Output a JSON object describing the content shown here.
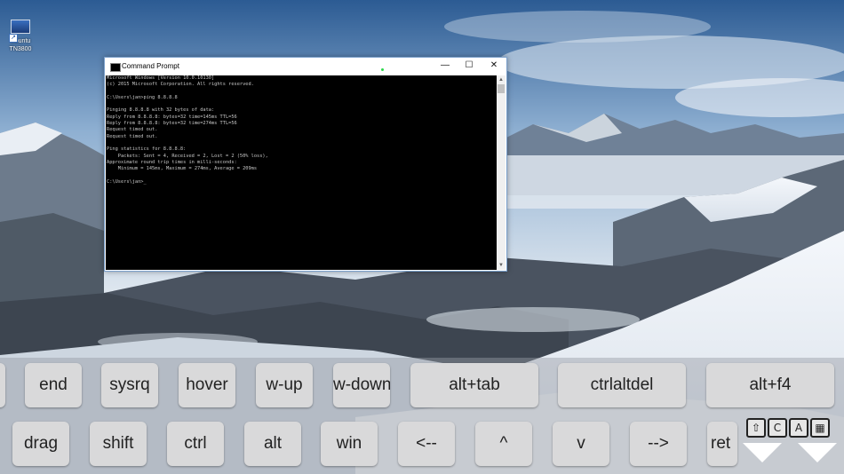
{
  "desktop": {
    "icon_label_line1": "Ubuntu",
    "icon_label_line2": "TN3800"
  },
  "cmd_window": {
    "title": "Command Prompt",
    "min_glyph": "—",
    "max_glyph": "☐",
    "close_glyph": "✕",
    "lines": [
      "Microsoft Windows [Version 10.0.10130]",
      "(c) 2015 Microsoft Corporation. All rights reserved.",
      "",
      "C:\\Users\\jan>ping 8.8.8.8",
      "",
      "Pinging 8.8.8.8 with 32 bytes of data:",
      "Reply from 8.8.8.8: bytes=32 time=145ms TTL=56",
      "Reply from 8.8.8.8: bytes=32 time=274ms TTL=56",
      "Request timed out.",
      "Request timed out.",
      "",
      "Ping statistics for 8.8.8.8:",
      "    Packets: Sent = 4, Received = 2, Lost = 2 (50% loss),",
      "Approximate round trip times in milli-seconds:",
      "    Minimum = 145ms, Maximum = 274ms, Average = 209ms",
      "",
      "C:\\Users\\jan>_"
    ]
  },
  "keys_row1": [
    "end",
    "sysrq",
    "hover",
    "w-up",
    "w-down",
    "alt+tab",
    "ctrlaltdel",
    "alt+f4"
  ],
  "keys_row2": [
    "drag",
    "shift",
    "ctrl",
    "alt",
    "win",
    "<--",
    "^",
    "v",
    "-->",
    "ret"
  ],
  "toolbar_icons": [
    "⇧",
    "C",
    "A",
    "▦"
  ]
}
